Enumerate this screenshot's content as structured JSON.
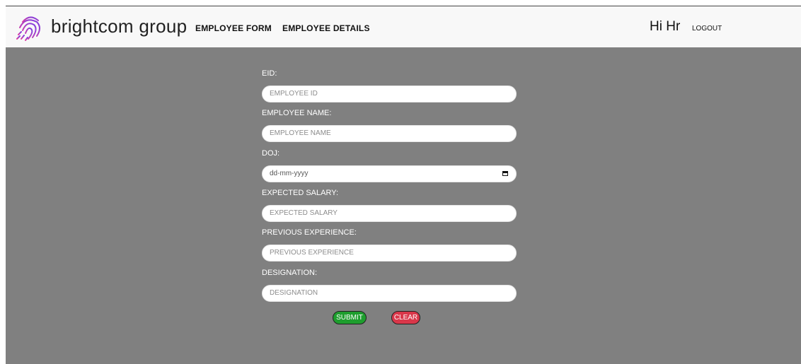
{
  "header": {
    "brand": "brightcom group",
    "nav": {
      "employee_form": "EMPLOYEE FORM",
      "employee_details": "EMPLOYEE DETAILS"
    },
    "greeting": "Hi Hr",
    "logout": "LOGOUT"
  },
  "form": {
    "fields": [
      {
        "label": "EID:",
        "placeholder": "EMPLOYEE ID"
      },
      {
        "label": "EMPLOYEE NAME:",
        "placeholder": "EMPLOYEE NAME"
      },
      {
        "label": "DOJ:",
        "placeholder": "dd-mm-yyyy"
      },
      {
        "label": "EXPECTED SALARY:",
        "placeholder": "EXPECTED SALARY"
      },
      {
        "label": "PREVIOUS EXPERIENCE:",
        "placeholder": "PREVIOUS EXPERIENCE"
      },
      {
        "label": "DESIGNATION:",
        "placeholder": "DESIGNATION"
      }
    ],
    "submit": "SUBMIT",
    "clear": "CLEAR"
  },
  "colors": {
    "background": "#808080",
    "navbar": "#f8f8f8",
    "submit": "#1e9e2e",
    "clear": "#d9374a",
    "logo_gradient": [
      "#7b3fe4",
      "#e040a0"
    ]
  },
  "icons": {
    "logo": "fingerprint-logo-icon",
    "date": "calendar-icon"
  }
}
